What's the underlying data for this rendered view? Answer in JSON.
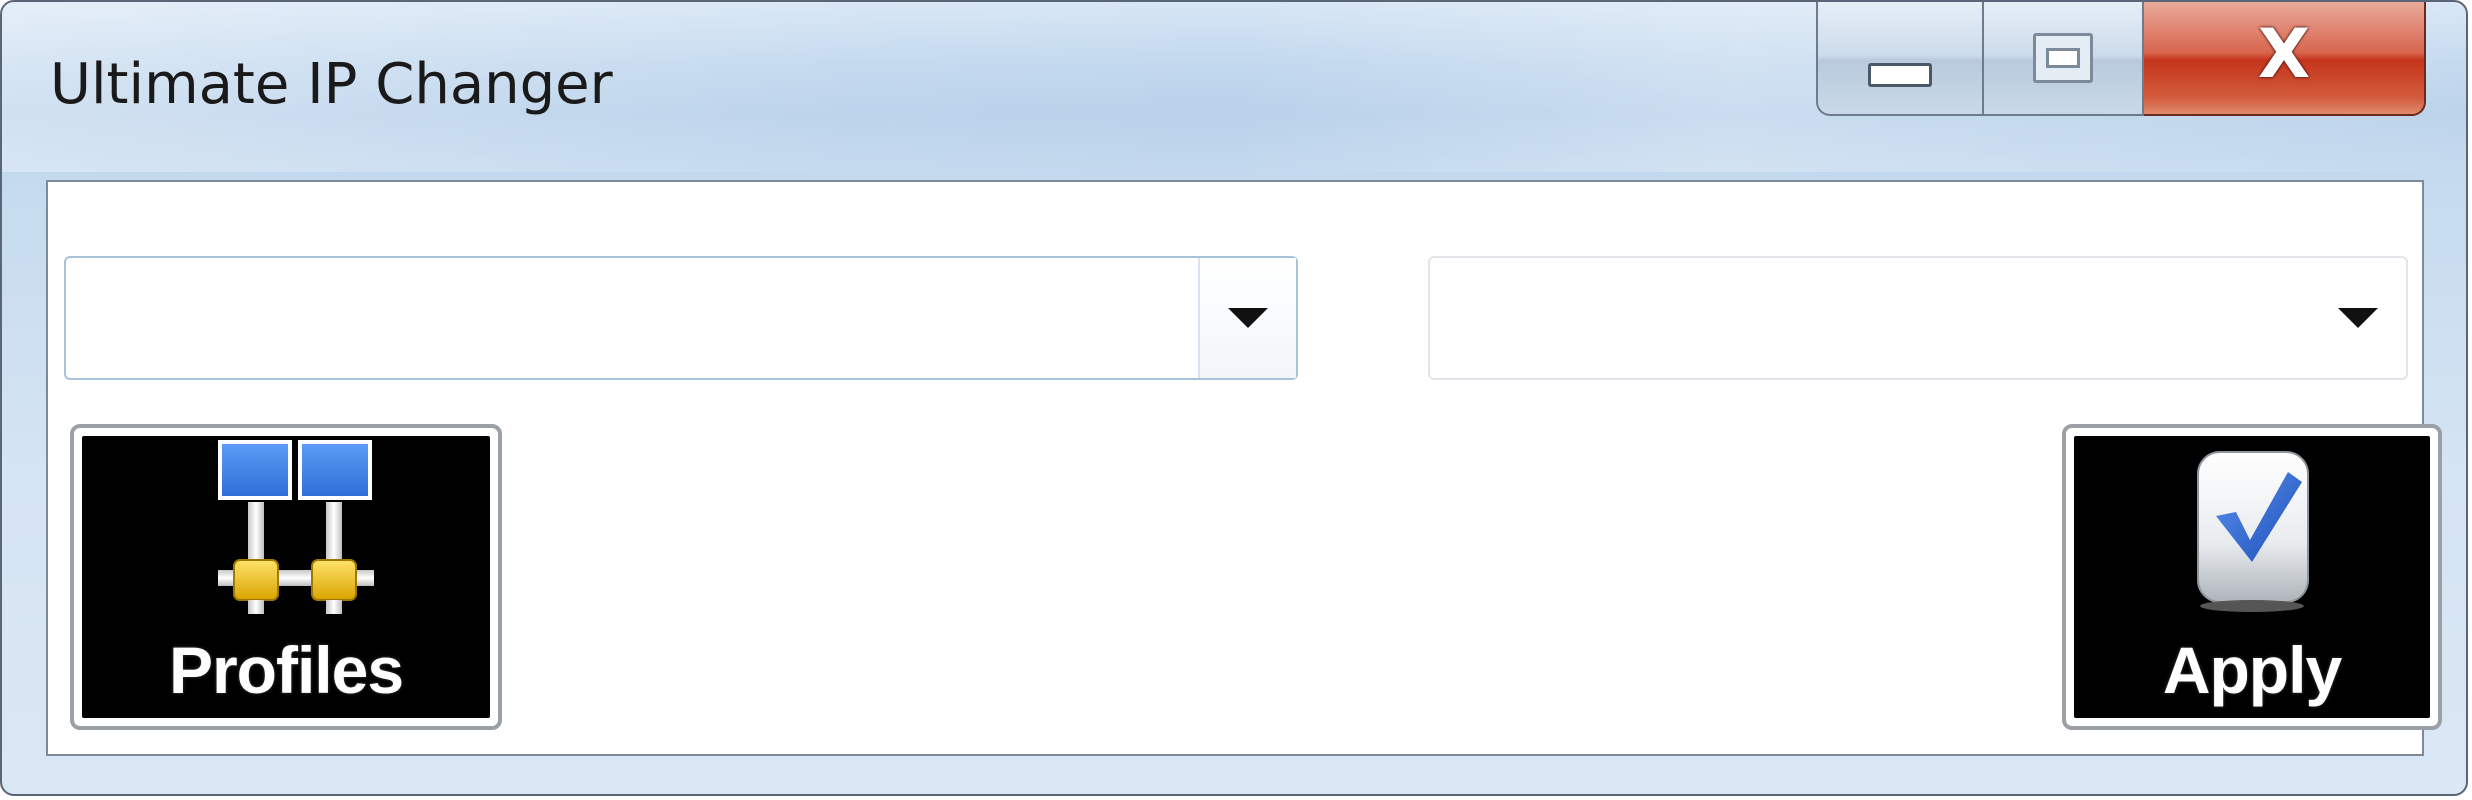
{
  "window": {
    "title": "Ultimate IP Changer",
    "close_glyph": "X"
  },
  "combos": {
    "adapter": {
      "value": ""
    },
    "profile": {
      "value": ""
    }
  },
  "buttons": {
    "profiles": {
      "label": "Profiles",
      "icon": "network-icon"
    },
    "apply": {
      "label": "Apply",
      "icon": "checkmark-icon"
    }
  },
  "colors": {
    "close_red": "#c5361c",
    "titlebar_blue": "#c2d8ee",
    "button_black": "#000000",
    "monitor_blue": "#3f7fe0",
    "connector_yellow": "#f2c200",
    "check_blue": "#2a62c9"
  }
}
